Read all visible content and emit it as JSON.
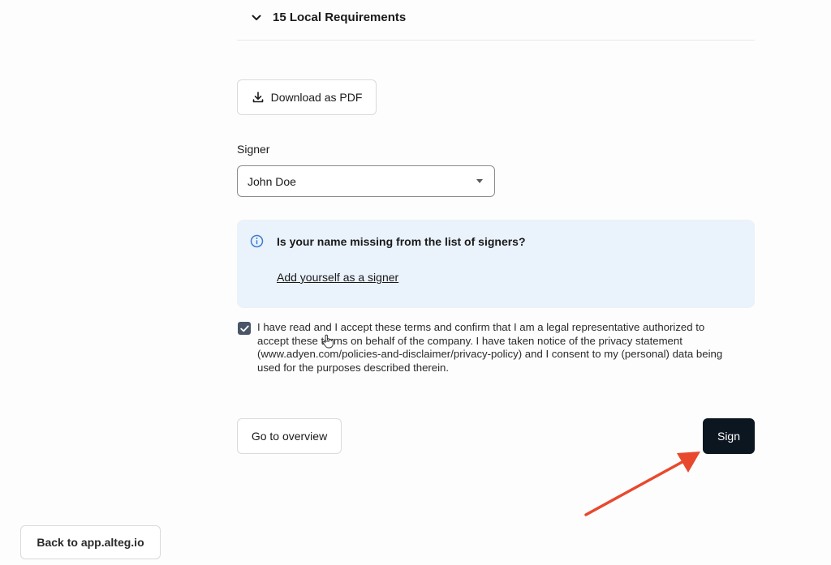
{
  "section": {
    "title": "15 Local Requirements"
  },
  "download": {
    "label": "Download as PDF"
  },
  "signer": {
    "label": "Signer",
    "selected": "John Doe"
  },
  "info": {
    "title": "Is your name missing from the list of signers?",
    "link": "Add yourself as a signer"
  },
  "consent": {
    "checked": true,
    "text": "I have read and I accept these terms and confirm that I am a legal representative authorized to accept these terms on behalf of the company. I have taken notice of the privacy statement (www.adyen.com/policies-and-disclaimer/privacy-policy) and I consent to my (personal) data being used for the purposes described therein."
  },
  "actions": {
    "overview": "Go to overview",
    "sign": "Sign"
  },
  "back": {
    "label": "Back to app.alteg.io"
  },
  "colors": {
    "sign_button": "#0b1620",
    "info_background": "#eaf2fb",
    "annotation_arrow": "#e8492e",
    "info_icon": "#3b7bd6"
  },
  "icons": {
    "section": "chevron-down-icon",
    "download": "download-icon",
    "info": "info-icon",
    "checkbox": "checkmark-icon",
    "select": "caret-down-icon"
  }
}
